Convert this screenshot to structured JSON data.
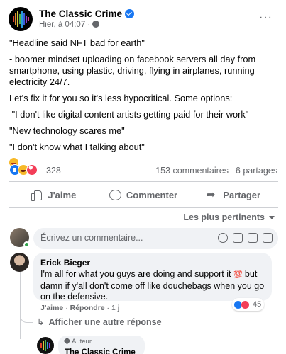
{
  "post": {
    "page_name": "The Classic Crime",
    "timestamp": "Hier, à 04:07 ·",
    "more": "···",
    "paragraphs": [
      "\"Headline said NFT bad for earth\"",
      "- boomer mindset uploading on facebook servers all day from smartphone, using plastic, driving, flying in airplanes, running electricity 24/7.",
      "Let's fix it for you so it's less hypocritical. Some options:",
      " \"I don't like digital content artists getting paid for their work\"",
      "\"New technology scares me\"",
      "\"I don't know what I talking about\""
    ]
  },
  "stats": {
    "reactions_count": "328",
    "comments": "153 commentaires",
    "shares": "6 partages"
  },
  "actions": {
    "like": "J'aime",
    "comment": "Commenter",
    "share": "Partager"
  },
  "sort_label": "Les plus pertinents",
  "composer": {
    "placeholder": "Écrivez un commentaire..."
  },
  "comment": {
    "author": "Erick Bieger",
    "text_before": "I'm all for what you guys are doing and support it ",
    "emoji": "💯",
    "text_after": " but damn if y'all don't come off like douchebags when you go on the defensive.",
    "like": "J'aime",
    "separator": " · ",
    "reply": "Répondre",
    "age": " · 1 j",
    "reaction_count": "45"
  },
  "other_reply": "Afficher une autre réponse",
  "reply": {
    "badge": "Auteur",
    "author": "The Classic Crime"
  },
  "colors": {
    "accent": "#1877f2",
    "love": "#f33e58",
    "haha": "#f7b928",
    "muted": "#65676b",
    "bubble": "#f0f2f5"
  }
}
